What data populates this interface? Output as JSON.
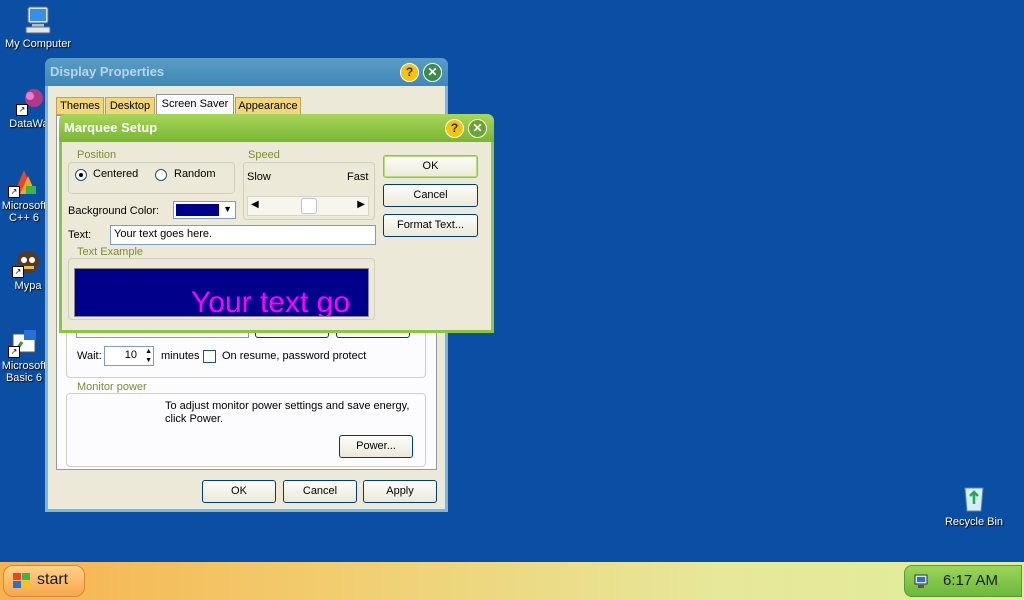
{
  "desktop": {
    "icons": [
      {
        "label": "My Computer"
      },
      {
        "label": "DataWag"
      },
      {
        "label": "Microsoft C++ 6"
      },
      {
        "label": "Mypa"
      },
      {
        "label": "Microsoft Basic 6"
      },
      {
        "label": "Recycle Bin"
      }
    ]
  },
  "display_properties": {
    "title": "Display Properties",
    "tabs": [
      {
        "label": "Themes"
      },
      {
        "label": "Desktop"
      },
      {
        "label": "Screen Saver"
      },
      {
        "label": "Appearance"
      }
    ],
    "wait_label": "Wait:",
    "wait_value": "10",
    "minutes_label": "minutes",
    "password_label": "On resume, password protect",
    "monitor_power_group": "Monitor power",
    "monitor_power_text": "To adjust monitor power settings and save energy, click Power.",
    "power_button": "Power...",
    "ok_button": "OK",
    "cancel_button": "Cancel",
    "apply_button": "Apply"
  },
  "marquee_setup": {
    "title": "Marquee Setup",
    "position_group": "Position",
    "centered_label": "Centered",
    "random_label": "Random",
    "speed_group": "Speed",
    "slow_label": "Slow",
    "fast_label": "Fast",
    "speed_level": 0.5,
    "bg_color_label": "Background Color:",
    "bg_color": "#00008b",
    "text_label": "Text:",
    "text_value": "Your text goes here.",
    "example_group": "Text Example",
    "example_text": "Your text go",
    "example_text_color": "#ff00ff",
    "ok_button": "OK",
    "cancel_button": "Cancel",
    "format_button": "Format Text..."
  },
  "taskbar": {
    "start_label": "start",
    "clock": "6:17 AM"
  }
}
